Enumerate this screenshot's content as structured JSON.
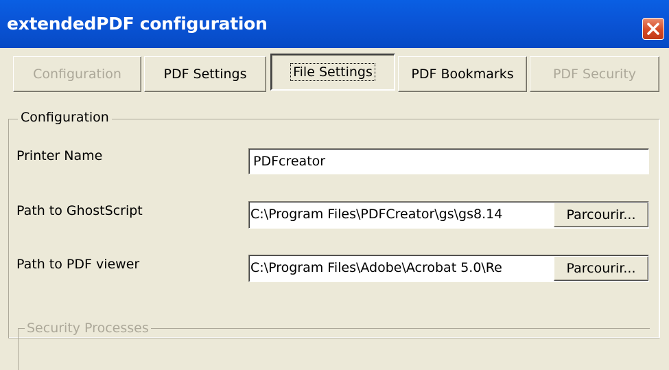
{
  "window": {
    "title": "extendedPDF configuration"
  },
  "tabs": [
    {
      "label": "Configuration",
      "state": "disabled"
    },
    {
      "label": "PDF Settings",
      "state": "normal"
    },
    {
      "label": "File Settings",
      "state": "active"
    },
    {
      "label": "PDF Bookmarks",
      "state": "normal"
    },
    {
      "label": "PDF Security",
      "state": "disabled"
    }
  ],
  "config_group": {
    "legend": "Configuration",
    "printer_name": {
      "label": "Printer Name",
      "value": "PDFcreator"
    },
    "ghostscript": {
      "label": "Path to GhostScript",
      "value": "C:\\Program Files\\PDFCreator\\gs\\gs8.14",
      "button": "Parcourir..."
    },
    "viewer": {
      "label": "Path to PDF viewer",
      "value": "C:\\Program Files\\Adobe\\Acrobat 5.0\\Re",
      "button": "Parcourir..."
    }
  },
  "security_group": {
    "legend": "Security Processes"
  },
  "colors": {
    "titlebar": "#0a54d6",
    "face": "#ece9d8",
    "close": "#d64a26"
  }
}
